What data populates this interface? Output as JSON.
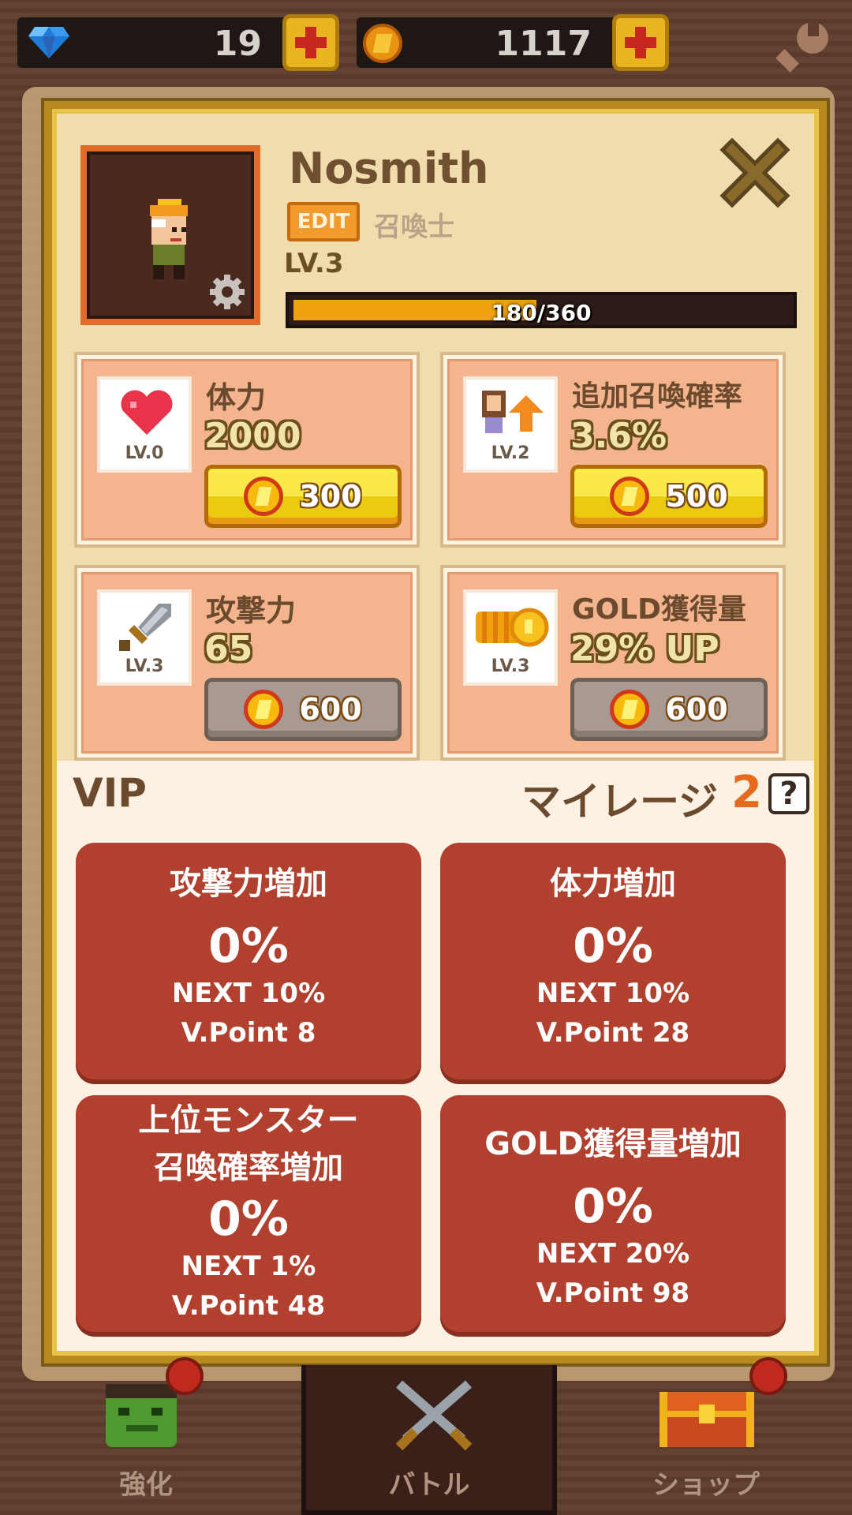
{
  "currency": {
    "gems": "19",
    "gold": "1117"
  },
  "profile": {
    "name": "Nosmith",
    "edit_label": "EDIT",
    "class_label": "召喚士",
    "level": "LV.3",
    "xp_text": "180/360",
    "xp_fraction": 0.5
  },
  "stats": [
    {
      "name": "体力",
      "value": "2000",
      "level": "LV.0",
      "cost": "300",
      "icon": "heart-icon",
      "enabled": true
    },
    {
      "name": "追加召喚確率",
      "value": "3.6%",
      "level": "LV.2",
      "cost": "500",
      "icon": "summon-up-icon",
      "enabled": true
    },
    {
      "name": "攻撃力",
      "value": "65",
      "level": "LV.3",
      "cost": "600",
      "icon": "sword-icon",
      "enabled": false
    },
    {
      "name": "GOLD獲得量",
      "value": "29% UP",
      "level": "LV.3",
      "cost": "600",
      "icon": "gold-coins-icon",
      "enabled": false
    }
  ],
  "vip": {
    "title": "VIP",
    "mileage_label": "マイレージ",
    "mileage_value": "2",
    "help_label": "?",
    "cards": [
      {
        "title": "攻撃力増加",
        "title2": "",
        "percent": "0%",
        "next": "NEXT 10%",
        "point": "V.Point 8"
      },
      {
        "title": "体力増加",
        "title2": "",
        "percent": "0%",
        "next": "NEXT 10%",
        "point": "V.Point 28"
      },
      {
        "title": "上位モンスター",
        "title2": "召喚確率増加",
        "percent": "0%",
        "next": "NEXT 1%",
        "point": "V.Point 48"
      },
      {
        "title": "GOLD獲得量増加",
        "title2": "",
        "percent": "0%",
        "next": "NEXT 20%",
        "point": "V.Point 98"
      }
    ]
  },
  "nav": {
    "left": "強化",
    "center": "バトル",
    "right": "ショップ"
  },
  "colors": {
    "accent_gold": "#f0a10e",
    "vip_card": "#b2402f",
    "stat_card": "#f3b48e"
  }
}
